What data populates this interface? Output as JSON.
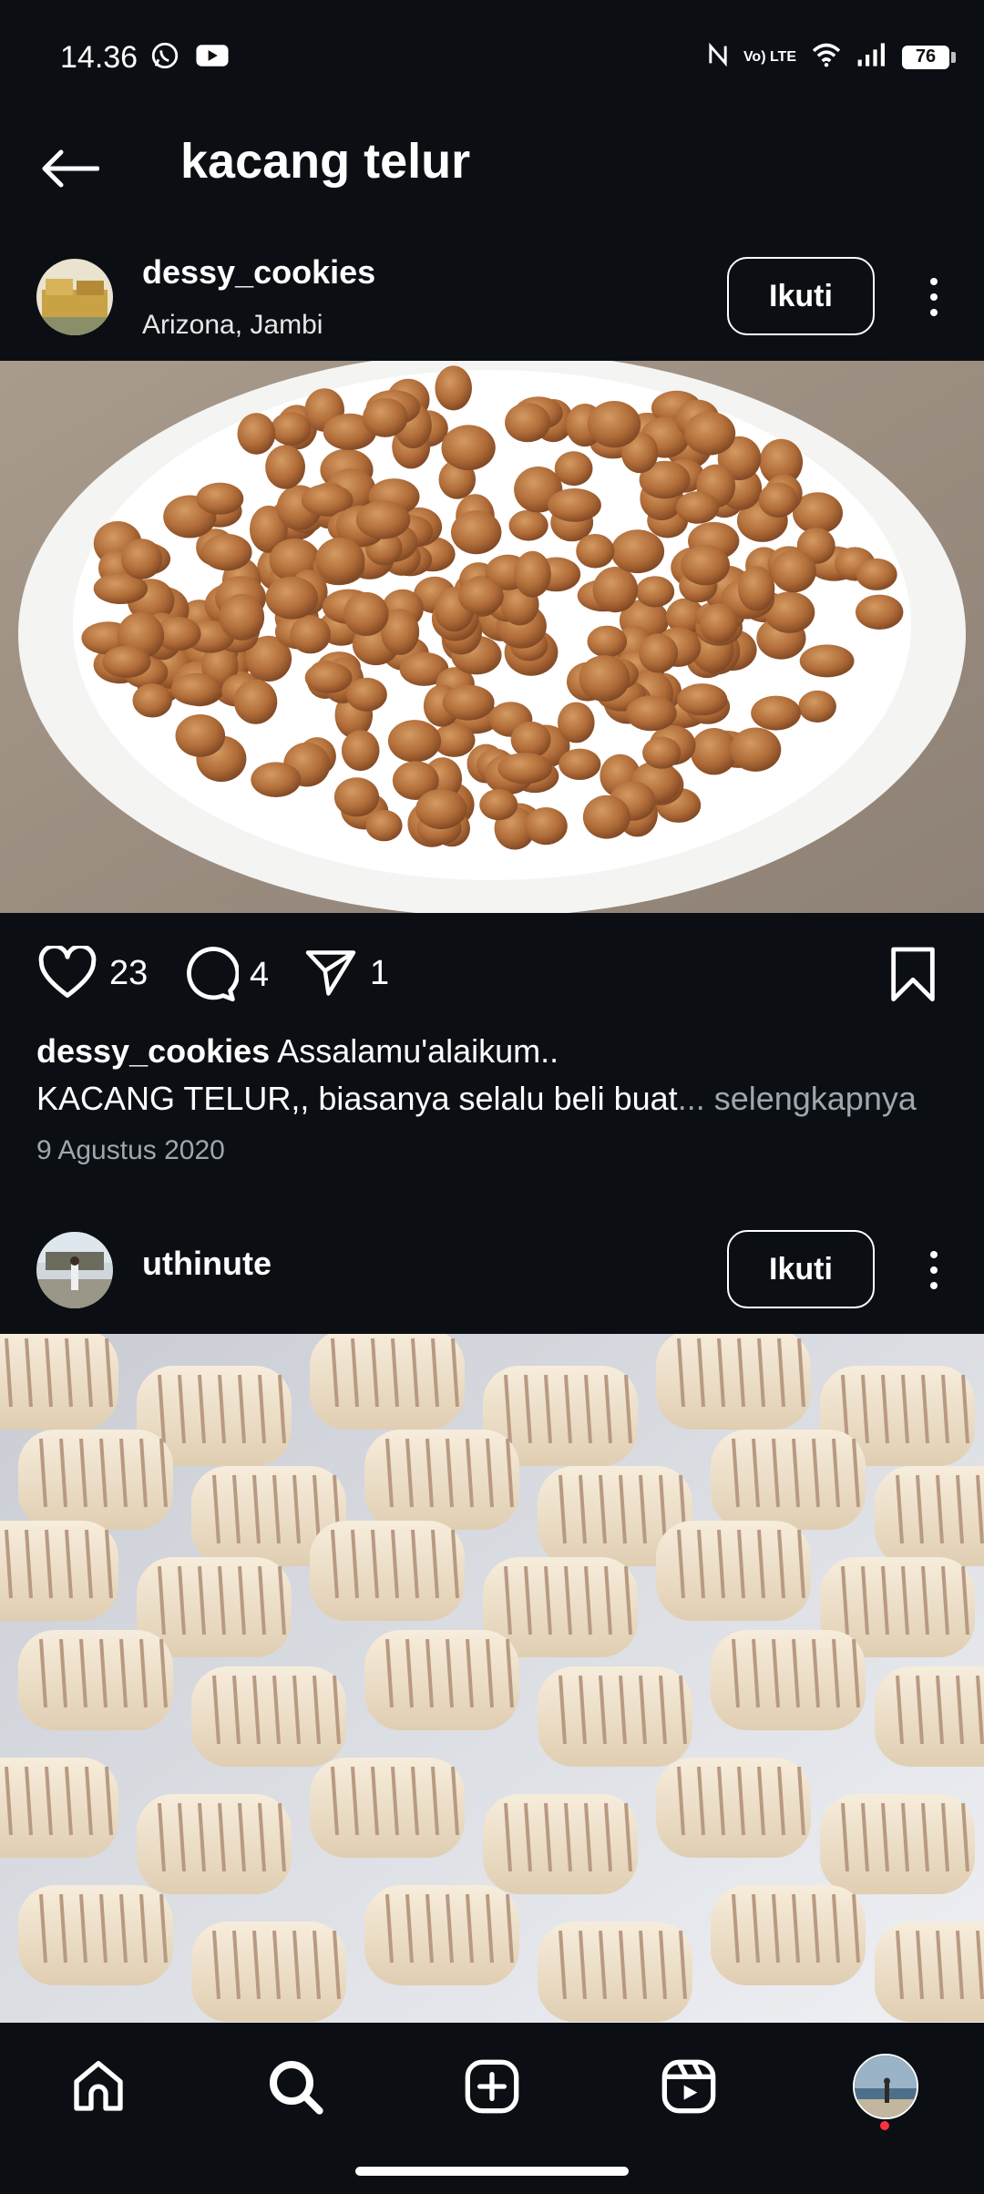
{
  "status_bar": {
    "time": "14.36",
    "left_icons": [
      "whatsapp-icon",
      "youtube-icon"
    ],
    "right_icons": [
      "nfc-icon",
      "volte-icon",
      "wifi-icon",
      "signal-icon"
    ],
    "volte_label": "Vo) LTE",
    "battery": "76"
  },
  "header": {
    "title": "kacang telur"
  },
  "posts": [
    {
      "username": "dessy_cookies",
      "location": "Arizona, Jambi",
      "follow_label": "Ikuti",
      "likes": "23",
      "comments": "4",
      "shares": "1",
      "caption_user": "dessy_cookies",
      "caption_line1": "Assalamu'alaikum..",
      "caption_line2": "KACANG TELUR,, biasanya selalu beli buat",
      "more_label": "... selengkapnya",
      "date": "9 Agustus 2020"
    },
    {
      "username": "uthinute",
      "follow_label": "Ikuti"
    }
  ],
  "bottom_nav": {
    "items": [
      "home-icon",
      "search-icon",
      "create-icon",
      "reels-icon",
      "profile-avatar"
    ],
    "notification_dot_color": "#ff3040"
  },
  "colors": {
    "background": "#0b0f14",
    "text": "#ffffff",
    "muted": "#a0a6ad"
  }
}
